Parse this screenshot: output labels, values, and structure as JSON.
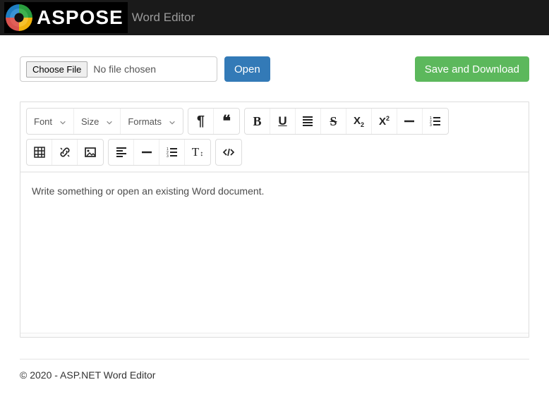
{
  "header": {
    "brand": "ASPOSE",
    "subtitle": "Word Editor"
  },
  "fileRow": {
    "chooseLabel": "Choose File",
    "noFileText": "No file chosen",
    "openLabel": "Open",
    "saveLabel": "Save and Download"
  },
  "toolbar": {
    "font": "Font",
    "size": "Size",
    "formats": "Formats"
  },
  "editor": {
    "placeholder": "Write something or open an existing Word document."
  },
  "footer": {
    "text": "© 2020 - ASP.NET Word Editor"
  }
}
